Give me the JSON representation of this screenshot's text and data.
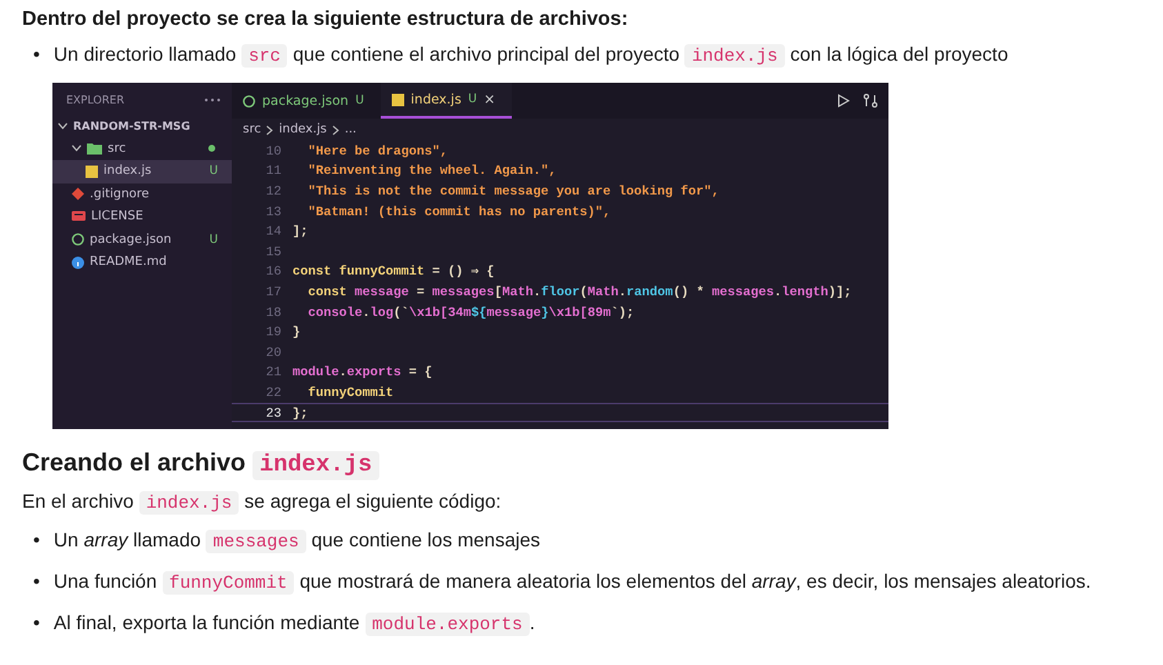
{
  "intro_heading": "Dentro del proyecto se crea la siguiente estructura de archivos:",
  "intro_bullets": [
    {
      "marker": "•",
      "parts": [
        {
          "kind": "text",
          "text": "Un directorio llamado "
        },
        {
          "kind": "code",
          "text": "src"
        },
        {
          "kind": "text",
          "text": " que contiene el archivo principal del proyecto "
        },
        {
          "kind": "code",
          "text": "index.js"
        },
        {
          "kind": "text",
          "text": "  con la lógica del proyecto"
        }
      ]
    }
  ],
  "editor": {
    "explorer": {
      "title": "EXPLORER",
      "tree": [
        {
          "label": "RANDOM-STR-MSG",
          "kind": "root",
          "expanded": true,
          "children": [
            {
              "label": "src",
              "kind": "folder",
              "expanded": true,
              "modified": true,
              "children": [
                {
                  "label": "index.js",
                  "kind": "js",
                  "selected": true,
                  "status": "U"
                }
              ]
            },
            {
              "label": ".gitignore",
              "kind": "git",
              "selected": false
            },
            {
              "label": "LICENSE",
              "kind": "license",
              "selected": false
            },
            {
              "label": "package.json",
              "kind": "json",
              "selected": false,
              "status": "U"
            },
            {
              "label": "README.md",
              "kind": "info",
              "selected": false
            }
          ]
        }
      ]
    },
    "tabs": [
      {
        "label": "package.json",
        "kind": "json",
        "badge": "U",
        "selected": false
      },
      {
        "label": "index.js",
        "kind": "js",
        "badge": "U",
        "close": "×",
        "selected": true
      }
    ],
    "breadcrumb": [
      "src",
      "index.js",
      "..."
    ],
    "lines": [
      {
        "number": "10",
        "active": false,
        "tokens": [
          {
            "kind": "string",
            "text": "  \"Here be dragons\","
          }
        ]
      },
      {
        "number": "11",
        "active": false,
        "tokens": [
          {
            "kind": "string",
            "text": "  \"Reinventing the wheel. Again.\","
          }
        ]
      },
      {
        "number": "12",
        "active": false,
        "tokens": [
          {
            "kind": "string",
            "text": "  \"This is not the commit message you are looking for\","
          }
        ]
      },
      {
        "number": "13",
        "active": false,
        "tokens": [
          {
            "kind": "string",
            "text": "  \"Batman! (this commit has no parents)\","
          }
        ]
      },
      {
        "number": "14",
        "active": false,
        "tokens": [
          {
            "kind": "punct",
            "text": "];"
          }
        ]
      },
      {
        "number": "15",
        "active": false
      },
      {
        "number": "16",
        "active": false,
        "tokens": [
          {
            "kind": "keyword",
            "text": "const "
          },
          {
            "kind": "name",
            "text": "funnyCommit "
          },
          {
            "kind": "punct",
            "text": "= () ⇒ {"
          }
        ]
      },
      {
        "number": "17",
        "active": false,
        "tokens": [
          {
            "kind": "keyword",
            "text": "  const "
          },
          {
            "kind": "variable",
            "text": "message "
          },
          {
            "kind": "punct",
            "text": "= "
          },
          {
            "kind": "variable",
            "text": "messages"
          },
          {
            "kind": "punct",
            "text": "["
          },
          {
            "kind": "variable",
            "text": "Math"
          },
          {
            "kind": "punct",
            "text": "."
          },
          {
            "kind": "function",
            "text": "floor"
          },
          {
            "kind": "punct",
            "text": "("
          },
          {
            "kind": "variable",
            "text": "Math"
          },
          {
            "kind": "punct",
            "text": "."
          },
          {
            "kind": "function",
            "text": "random"
          },
          {
            "kind": "punct",
            "text": "() * "
          },
          {
            "kind": "variable",
            "text": "messages"
          },
          {
            "kind": "punct",
            "text": "."
          },
          {
            "kind": "variable",
            "text": "length"
          },
          {
            "kind": "punct",
            "text": ")];"
          }
        ]
      },
      {
        "number": "18",
        "active": false,
        "tokens": [
          {
            "kind": "variable",
            "text": "  console"
          },
          {
            "kind": "punct",
            "text": "."
          },
          {
            "kind": "variable",
            "text": "log"
          },
          {
            "kind": "punct",
            "text": "(`"
          },
          {
            "kind": "variable",
            "text": "\\x1b[34m"
          },
          {
            "kind": "function",
            "text": "${"
          },
          {
            "kind": "variable",
            "text": "message"
          },
          {
            "kind": "function",
            "text": "}"
          },
          {
            "kind": "variable",
            "text": "\\x1b[89m"
          },
          {
            "kind": "punct",
            "text": "`);"
          }
        ]
      },
      {
        "number": "19",
        "active": false,
        "tokens": [
          {
            "kind": "punct",
            "text": "}"
          }
        ]
      },
      {
        "number": "20",
        "active": false
      },
      {
        "number": "21",
        "active": false,
        "tokens": [
          {
            "kind": "variable",
            "text": "module"
          },
          {
            "kind": "punct",
            "text": "."
          },
          {
            "kind": "variable",
            "text": "exports "
          },
          {
            "kind": "punct",
            "text": "= {"
          }
        ]
      },
      {
        "number": "22",
        "active": false,
        "tokens": [
          {
            "kind": "name",
            "text": "  funnyCommit"
          }
        ]
      },
      {
        "number": "23",
        "active": true,
        "tokens": [
          {
            "kind": "punct",
            "text": "};"
          }
        ]
      }
    ]
  },
  "section_heading": [
    {
      "kind": "text",
      "text": "Creando el archivo "
    },
    {
      "kind": "code",
      "text": "index.js"
    }
  ],
  "paragraph": [
    {
      "kind": "text",
      "text": "En el archivo "
    },
    {
      "kind": "code",
      "text": "index.js"
    },
    {
      "kind": "text",
      "text": " se agrega el siguiente código:"
    }
  ],
  "bullets": [
    {
      "marker": "•",
      "parts": [
        {
          "kind": "text",
          "text": "Un *array* llamado "
        },
        {
          "kind": "code",
          "text": "messages"
        },
        {
          "kind": "text",
          "text": " que contiene los mensajes"
        }
      ]
    },
    {
      "marker": "•",
      "parts": [
        {
          "kind": "text",
          "text": "Una función "
        },
        {
          "kind": "code",
          "text": "funnyCommit"
        },
        {
          "kind": "text",
          "text": " que mostrará de manera aleatoria los elementos del *array*, es decir, los mensajes aleatorios."
        }
      ]
    },
    {
      "marker": "•",
      "parts": [
        {
          "kind": "text",
          "text": "Al final, exporta la función mediante "
        },
        {
          "kind": "code",
          "text": "module.exports"
        },
        {
          "kind": "text",
          "text": "."
        }
      ]
    }
  ]
}
